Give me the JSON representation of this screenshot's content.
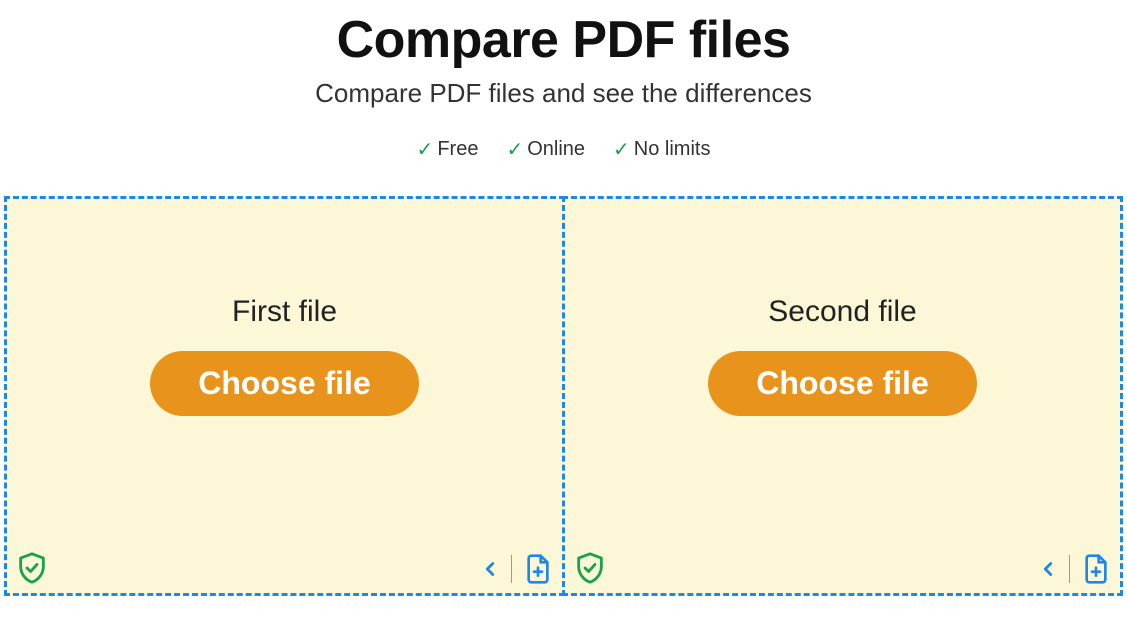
{
  "header": {
    "title": "Compare PDF files",
    "subtitle": "Compare PDF files and see the differences"
  },
  "features": {
    "item1": "Free",
    "item2": "Online",
    "item3": "No limits"
  },
  "dropzones": {
    "first": {
      "label": "First file",
      "button": "Choose file"
    },
    "second": {
      "label": "Second file",
      "button": "Choose file"
    }
  },
  "colors": {
    "accent_orange": "#e8941c",
    "border_blue": "#1e88e5",
    "bg_cream": "#fbf7d7",
    "check_green": "#19a24a"
  }
}
